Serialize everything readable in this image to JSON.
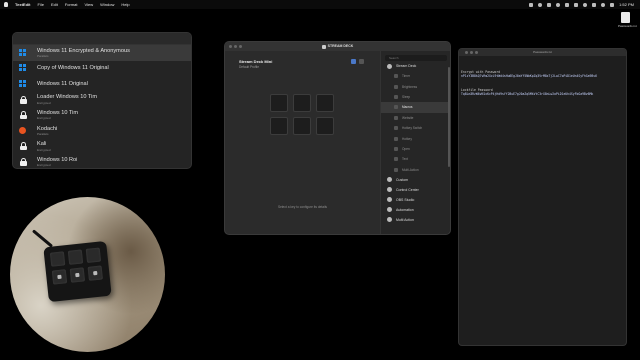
{
  "menubar": {
    "app_name": "TextEdit",
    "menus": [
      "File",
      "Edit",
      "Format",
      "View",
      "Window",
      "Help"
    ],
    "clock": "1:52 PM"
  },
  "desktop": {
    "file_icon_label": "Passwords.txt"
  },
  "launcher": {
    "search_placeholder": "",
    "items": [
      {
        "name": "Windows 11 Encrypted & Anonymous",
        "sub": "Parallels",
        "icon": "windows-icon",
        "selected": true
      },
      {
        "name": "Copy of Windows 11 Original",
        "sub": "",
        "icon": "windows-icon",
        "selected": false
      },
      {
        "name": "Windows 11 Original",
        "sub": "",
        "icon": "windows-icon",
        "selected": false
      },
      {
        "name": "Loader Windows 10 Tim",
        "sub": "Encrypted",
        "icon": "lock-icon",
        "selected": false
      },
      {
        "name": "Windows 10 Tim",
        "sub": "Encrypted",
        "icon": "lock-icon",
        "selected": false
      },
      {
        "name": "Kodachi",
        "sub": "Parallels",
        "icon": "ubuntu-icon",
        "selected": false
      },
      {
        "name": "Kali",
        "sub": "Encrypted",
        "icon": "lock-icon",
        "selected": false
      },
      {
        "name": "Windows 10 Roi",
        "sub": "Encrypted",
        "icon": "lock-icon",
        "selected": false
      }
    ]
  },
  "streamdeck": {
    "title": "STREAM DECK",
    "device_name": "Stream Deck Mini",
    "profile": "Default Profile",
    "keys": [
      "",
      "",
      "",
      "",
      "",
      ""
    ],
    "hint": "Select a key to configure its details",
    "search_placeholder": "Search",
    "categories": [
      {
        "label": "Stream Deck",
        "sub": [
          "Timer",
          "Brightness",
          "Sleep",
          "Macros",
          "Website",
          "Hotkey Switch",
          "Hotkey",
          "Open",
          "Text",
          "Multi-Action"
        ]
      },
      {
        "label": "Custom",
        "sub": []
      },
      {
        "label": "Control Center",
        "sub": []
      },
      {
        "label": "OBS Studio",
        "sub": []
      },
      {
        "label": "Automation",
        "sub": []
      },
      {
        "label": "Multi Action",
        "sub": []
      }
    ],
    "selected_sub": "Macros"
  },
  "editor": {
    "title": "Passwords.txt",
    "lines": [
      "Encrypt with Password",
      "nP1zY3B8kQ7vRm2XcL9tWd4sHu6EgJ0aYf5NbKpZq3VrM8xTj2LwC7oPiD1eUn4SyFhGa9Bv6",
      "",
      "Lockfile Password",
      "Tq8Lm3RzW6vN1xKcP4jHd9sYf2BuE7gJ0aZq5MkVtC3rX8nLw2oPiD1eUh4SyFbGa9Bv6Mk"
    ]
  }
}
